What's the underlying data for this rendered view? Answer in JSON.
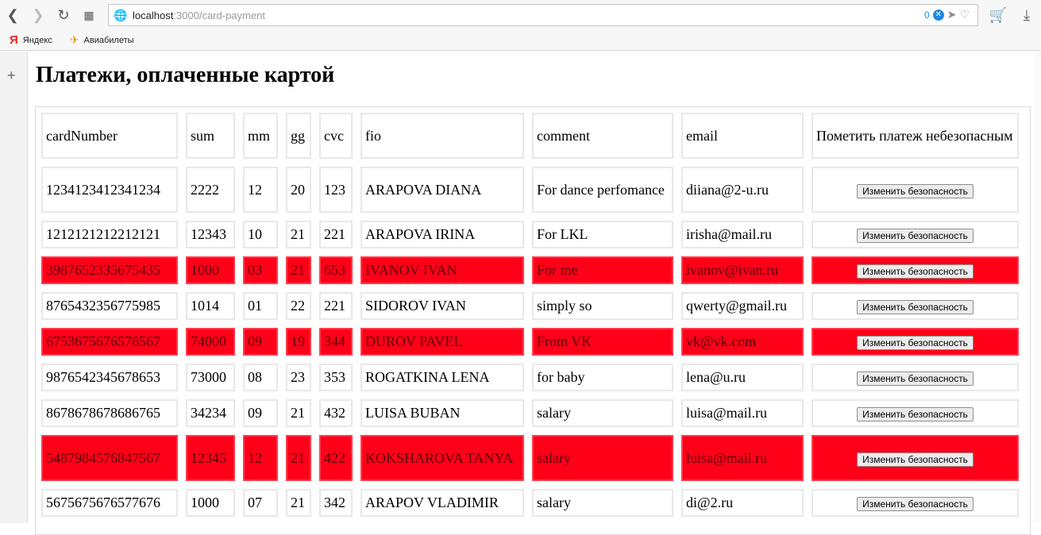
{
  "browser": {
    "url_host": "localhost",
    "url_path": ":3000/card-payment",
    "badge_count": "0",
    "bookmarks": [
      "Яндекс",
      "Авиабилеты"
    ]
  },
  "page": {
    "title": "Платежи, оплаченные картой"
  },
  "table": {
    "headers": [
      "cardNumber",
      "sum",
      "mm",
      "gg",
      "cvc",
      "fio",
      "comment",
      "email",
      "Пометить платеж небезопасным"
    ],
    "button_label": "Изменить безопасность",
    "rows": [
      {
        "cardNumber": "1234123412341234",
        "sum": "2222",
        "mm": "12",
        "gg": "20",
        "cvc": "123",
        "fio": "ARAPOVA DIANA",
        "comment": "For dance perfomance",
        "email": "diiana@2-u.ru",
        "unsafe": false
      },
      {
        "cardNumber": "1212121212212121",
        "sum": "12343",
        "mm": "10",
        "gg": "21",
        "cvc": "221",
        "fio": "ARAPOVA IRINA",
        "comment": "For LKL",
        "email": "irisha@mail.ru",
        "unsafe": false
      },
      {
        "cardNumber": "3987652335675435",
        "sum": "1000",
        "mm": "03",
        "gg": "21",
        "cvc": "653",
        "fio": "IVANOV IVAN",
        "comment": "For me",
        "email": "ivanov@ivan.ru",
        "unsafe": true
      },
      {
        "cardNumber": "8765432356775985",
        "sum": "1014",
        "mm": "01",
        "gg": "22",
        "cvc": "221",
        "fio": "SIDOROV IVAN",
        "comment": "simply so",
        "email": "qwerty@gmail.ru",
        "unsafe": false
      },
      {
        "cardNumber": "6753675676576567",
        "sum": "74000",
        "mm": "09",
        "gg": "19",
        "cvc": "344",
        "fio": "DUROV PAVEL",
        "comment": "From VK",
        "email": "vk@vk.com",
        "unsafe": true
      },
      {
        "cardNumber": "9876542345678653",
        "sum": "73000",
        "mm": "08",
        "gg": "23",
        "cvc": "353",
        "fio": "ROGATKINA LENA",
        "comment": "for baby",
        "email": "lena@u.ru",
        "unsafe": false
      },
      {
        "cardNumber": "8678678678686765",
        "sum": "34234",
        "mm": "09",
        "gg": "21",
        "cvc": "432",
        "fio": "LUISA BUBAN",
        "comment": "salary",
        "email": "luisa@mail.ru",
        "unsafe": false
      },
      {
        "cardNumber": "5487984576847567",
        "sum": "12345",
        "mm": "12",
        "gg": "21",
        "cvc": "422",
        "fio": "KOKSHAROVA TANYA",
        "comment": "salary",
        "email": "luisa@mail.ru",
        "unsafe": true
      },
      {
        "cardNumber": "5675675676577676",
        "sum": "1000",
        "mm": "07",
        "gg": "21",
        "cvc": "342",
        "fio": "ARAPOV VLADIMIR",
        "comment": "salary",
        "email": "di@2.ru",
        "unsafe": false
      }
    ]
  }
}
